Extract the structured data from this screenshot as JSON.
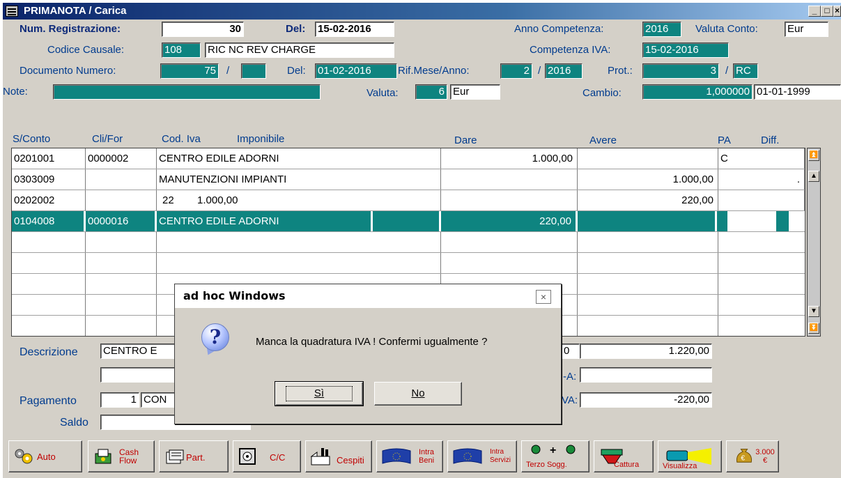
{
  "window": {
    "title": "PRIMANOTA / Carica",
    "minimize": "_",
    "maximize": "□",
    "close": "×"
  },
  "header": {
    "num_reg_label": "Num. Registrazione:",
    "num_reg_value": "30",
    "del_label": "Del:",
    "del_value": "15-02-2016",
    "anno_comp_label": "Anno Competenza:",
    "anno_comp_value": "2016",
    "valuta_conto_label": "Valuta Conto:",
    "valuta_conto_value": "Eur",
    "codice_causale_label": "Codice Causale:",
    "codice_causale_code": "108",
    "codice_causale_desc": "RIC NC REV CHARGE",
    "comp_iva_label": "Competenza IVA:",
    "comp_iva_value": "15-02-2016",
    "doc_num_label": "Documento Numero:",
    "doc_num_value": "75",
    "doc_sep": "/",
    "doc_suffix": "",
    "doc_del_label": "Del:",
    "doc_del_value": "01-02-2016",
    "rif_label": "Rif.Mese/Anno:",
    "rif_mese": "2",
    "rif_sep": "/",
    "rif_anno": "2016",
    "prot_label": "Prot.:",
    "prot_value": "3",
    "prot_sep": "/",
    "prot_suffix": "RC",
    "note_label": "Note:",
    "note_value": "",
    "valuta_label": "Valuta:",
    "valuta_code": "6",
    "valuta_value": "Eur",
    "cambio_label": "Cambio:",
    "cambio_value": "1,000000",
    "cambio_date": "01-01-1999"
  },
  "grid": {
    "headers": [
      "S/Conto",
      "Cli/For",
      "Cod. Iva",
      "Imponibile",
      "Dare",
      "Avere",
      "PA",
      "Diff."
    ],
    "rows": [
      {
        "sconto": "0201001",
        "clifor": "0000002",
        "desc": "CENTRO EDILE ADORNI",
        "dare": "1.000,00",
        "avere": "",
        "pa": "C",
        "diff": ""
      },
      {
        "sconto": "0303009",
        "clifor": "",
        "desc": "MANUTENZIONI IMPIANTI",
        "dare": "",
        "avere": "1.000,00",
        "pa": "",
        "diff": "."
      },
      {
        "sconto": "0202002",
        "clifor": "",
        "desc": "22        1.000,00",
        "dare": "",
        "avere": "220,00",
        "pa": "",
        "diff": ""
      },
      {
        "sconto": "0104008",
        "clifor": "0000016",
        "desc": "CENTRO EDILE ADORNI",
        "dare": "220,00",
        "avere": "",
        "pa": "",
        "diff": ""
      }
    ]
  },
  "footer": {
    "descrizione_label": "Descrizione",
    "descrizione_value": "CENTRO E",
    "descrizione2_value": "",
    "pagamento_label": "Pagamento",
    "pagamento_code": "1",
    "pagamento_value": "CON",
    "saldo_label": "Saldo",
    "saldo_value": "",
    "tot1_prefix": "0",
    "tot1_value": "1.220,00",
    "tot2_prefix": "-A:",
    "tot2_value": "",
    "tot3_prefix": "VA:",
    "tot3_value": "-220,00"
  },
  "dialog": {
    "title": "ad hoc Windows",
    "close": "×",
    "icon": "question-icon",
    "message": "Manca la quadratura IVA ! Confermi ugualmente ?",
    "yes_label": "Sì",
    "no_label": "No"
  },
  "toolbar": [
    {
      "label": "Auto",
      "icon": "gears-icon"
    },
    {
      "label": "Cash Flow",
      "icon": "cash-flow-icon"
    },
    {
      "label": "Part.",
      "icon": "documents-icon"
    },
    {
      "label": "C/C",
      "icon": "safe-icon"
    },
    {
      "label": "Cespiti",
      "icon": "factory-icon"
    },
    {
      "label": "Intra Beni",
      "icon": "eu-flag-icon"
    },
    {
      "label": "Intra Servizi",
      "icon": "eu-flag-icon"
    },
    {
      "label": "Terzo Sogg.",
      "icon": "people-icon"
    },
    {
      "label": "Cattura",
      "icon": "capture-icon"
    },
    {
      "label": "Visualizza",
      "icon": "camera-icon"
    },
    {
      "label": "3.000 €",
      "icon": "money-bag-icon"
    }
  ],
  "colors": {
    "teal": "#0e8480",
    "label_blue": "#003b8e",
    "dialog_bg": "#d4d0c8"
  }
}
